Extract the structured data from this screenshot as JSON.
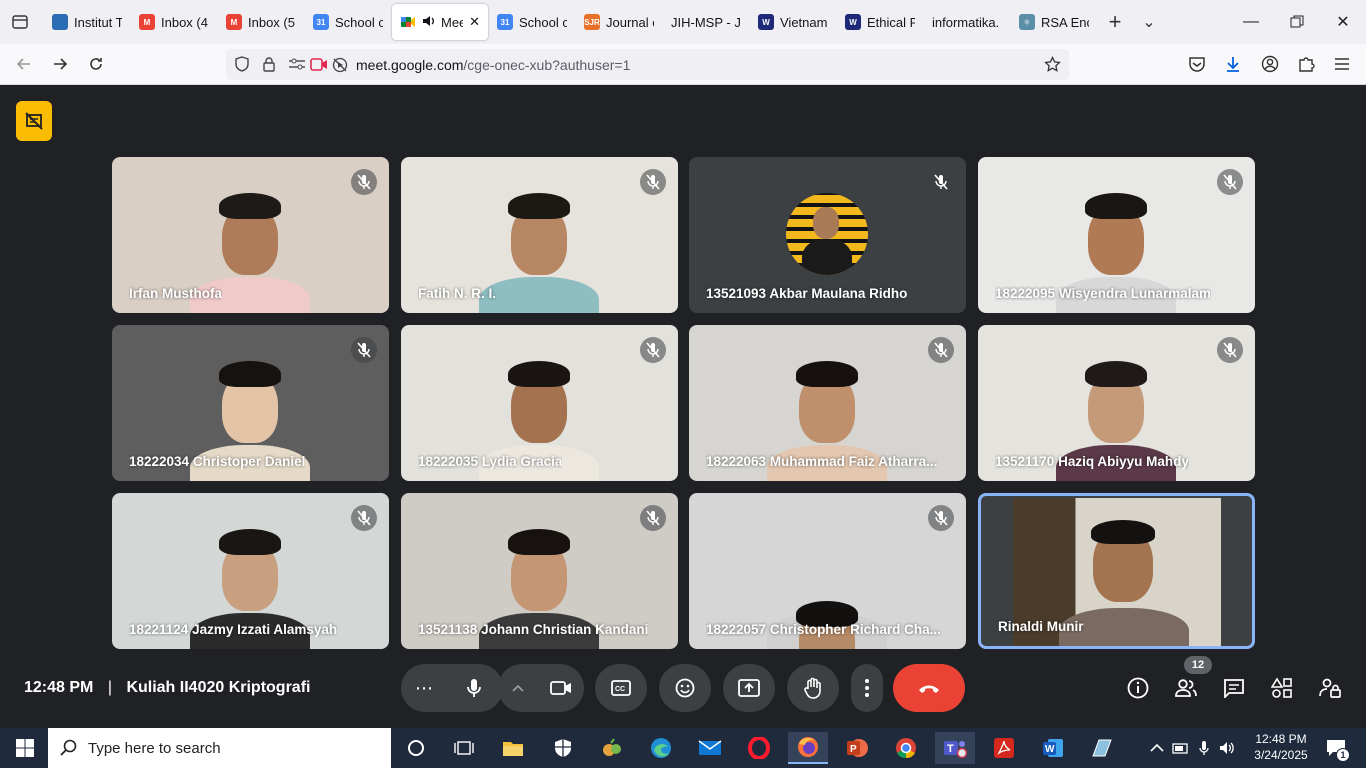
{
  "browser": {
    "tabs": [
      {
        "title": "Institut T",
        "color": "#2a6db5",
        "letter": ""
      },
      {
        "title": "Inbox (4",
        "color": "#ea4335",
        "letter": "M"
      },
      {
        "title": "Inbox (5",
        "color": "#ea4335",
        "letter": "M"
      },
      {
        "title": "School c",
        "color": "#4285f4",
        "letter": "31"
      },
      {
        "title": "Mee",
        "color": "#00832d",
        "letter": ""
      },
      {
        "title": "School c",
        "color": "#4285f4",
        "letter": "31"
      },
      {
        "title": "Journal c",
        "color": "#e8702a",
        "letter": "SJR"
      },
      {
        "title": "JIH-MSP - Jo",
        "color": "",
        "letter": ""
      },
      {
        "title": "Vietnam",
        "color": "#1e2a78",
        "letter": "W"
      },
      {
        "title": "Ethical P",
        "color": "#1e2a78",
        "letter": "W"
      },
      {
        "title": "informatika.",
        "color": "",
        "letter": ""
      },
      {
        "title": "RSA Encr",
        "color": "#5b8fa8",
        "letter": "⚛"
      }
    ],
    "new_tab": "+",
    "tab_list": "⌄",
    "url_domain": "meet.google.com",
    "url_path": "/cge-onec-xub?authuser=1"
  },
  "meeting": {
    "time": "12:48 PM",
    "separator": "|",
    "title": "Kuliah II4020 Kriptografi",
    "participant_count": "12",
    "participants": [
      {
        "name": "Irfan Musthofa",
        "bg": "#d9cfc4",
        "skin": "#b07b58",
        "hair": "#1d1a18",
        "shirt": "#f0c9c9"
      },
      {
        "name": "Fatih N. R. I.",
        "bg": "#e6e3dc",
        "skin": "#b78663",
        "hair": "#1c1814",
        "shirt": "#8fbec2"
      },
      {
        "name": "13521093 Akbar Maulana Ridho",
        "bg": "#3c4043",
        "skin": "#a87a55",
        "hair": "#111",
        "shirt": "#222"
      },
      {
        "name": "18222095 Wisyendra Lunarmalam",
        "bg": "#e8e8e6",
        "skin": "#b07a55",
        "hair": "#1a1613",
        "shirt": "#d8d8d8"
      },
      {
        "name": "18222034 Christoper Daniel",
        "bg": "#5e5e5e",
        "skin": "#e4c4a6",
        "hair": "#15120f",
        "shirt": "#e5d9c7"
      },
      {
        "name": "18222035 Lydia Gracia",
        "bg": "#e3e1dc",
        "skin": "#a5724f",
        "hair": "#1a1512",
        "shirt": "#ece8e0"
      },
      {
        "name": "18222063 Muhammad Faiz Atharra...",
        "bg": "#d7d5d1",
        "skin": "#c0906c",
        "hair": "#16110e",
        "shirt": "#e3c7b0"
      },
      {
        "name": "13521170 Haziq Abiyyu Mahdy",
        "bg": "#e5e3dd",
        "skin": "#c49a78",
        "hair": "#1f1a17",
        "shirt": "#5b3948"
      },
      {
        "name": "18221124 Jazmy Izzati Alamsyah",
        "bg": "#d3d8d6",
        "skin": "#c8a080",
        "hair": "#1a1614",
        "shirt": "#2b2b2b"
      },
      {
        "name": "13521138 Johann Christian Kandani",
        "bg": "#cfcbc5",
        "skin": "#c49673",
        "hair": "#17120f",
        "shirt": "#3b3b3b"
      },
      {
        "name": "18222057 Christopher Richard Cha...",
        "bg": "#d6d6d6",
        "skin": "#b58a66",
        "hair": "#131010",
        "shirt": "#d0d0d0"
      },
      {
        "name": "Rinaldi Munir",
        "bg": "#6b5a47",
        "skin": "#a47350",
        "hair": "#141210",
        "shirt": "#7a6a60"
      }
    ]
  },
  "taskbar": {
    "search_placeholder": "Type here to search",
    "clock_time": "12:48 PM",
    "clock_date": "3/24/2025",
    "notification_count": "1"
  },
  "colors": {
    "meet_bg": "#202124",
    "active_speaker_border": "#8ab4f8",
    "end_call": "#ea4335",
    "taskbar_bg": "#1f2a3c",
    "meet_badge": "#fbbc04"
  }
}
